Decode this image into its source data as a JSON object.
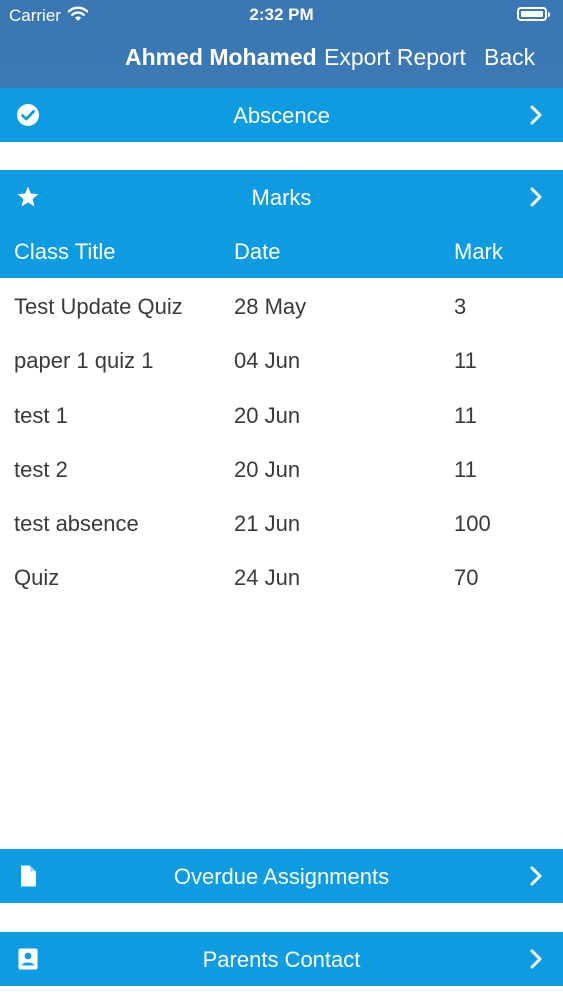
{
  "status_bar": {
    "carrier": "Carrier",
    "time": "2:32 PM"
  },
  "nav": {
    "student_name": "Ahmed Mohamed",
    "export_label": "Export Report",
    "back_label": "Back"
  },
  "sections": {
    "absence": {
      "label": "Abscence",
      "icon": "check-circle-icon"
    },
    "marks": {
      "label": "Marks",
      "icon": "star-icon"
    },
    "overdue": {
      "label": "Overdue Assignments",
      "icon": "document-icon"
    },
    "parents": {
      "label": "Parents Contact",
      "icon": "contact-card-icon"
    }
  },
  "marks_table": {
    "headers": {
      "class_title": "Class Title",
      "date": "Date",
      "mark": "Mark"
    },
    "rows": [
      {
        "class_title": "Test Update Quiz",
        "date": "28 May",
        "mark": "3"
      },
      {
        "class_title": "paper 1 quiz 1",
        "date": "04 Jun",
        "mark": "11"
      },
      {
        "class_title": "test 1",
        "date": "20 Jun",
        "mark": "11"
      },
      {
        "class_title": "test 2",
        "date": "20 Jun",
        "mark": "11"
      },
      {
        "class_title": "test absence",
        "date": "21 Jun",
        "mark": "100"
      },
      {
        "class_title": "Quiz",
        "date": "24 Jun",
        "mark": "70"
      }
    ]
  },
  "colors": {
    "nav_bar": "#3b78b4",
    "section_bar": "#0d9be2",
    "row_text": "#3a3a3a"
  }
}
